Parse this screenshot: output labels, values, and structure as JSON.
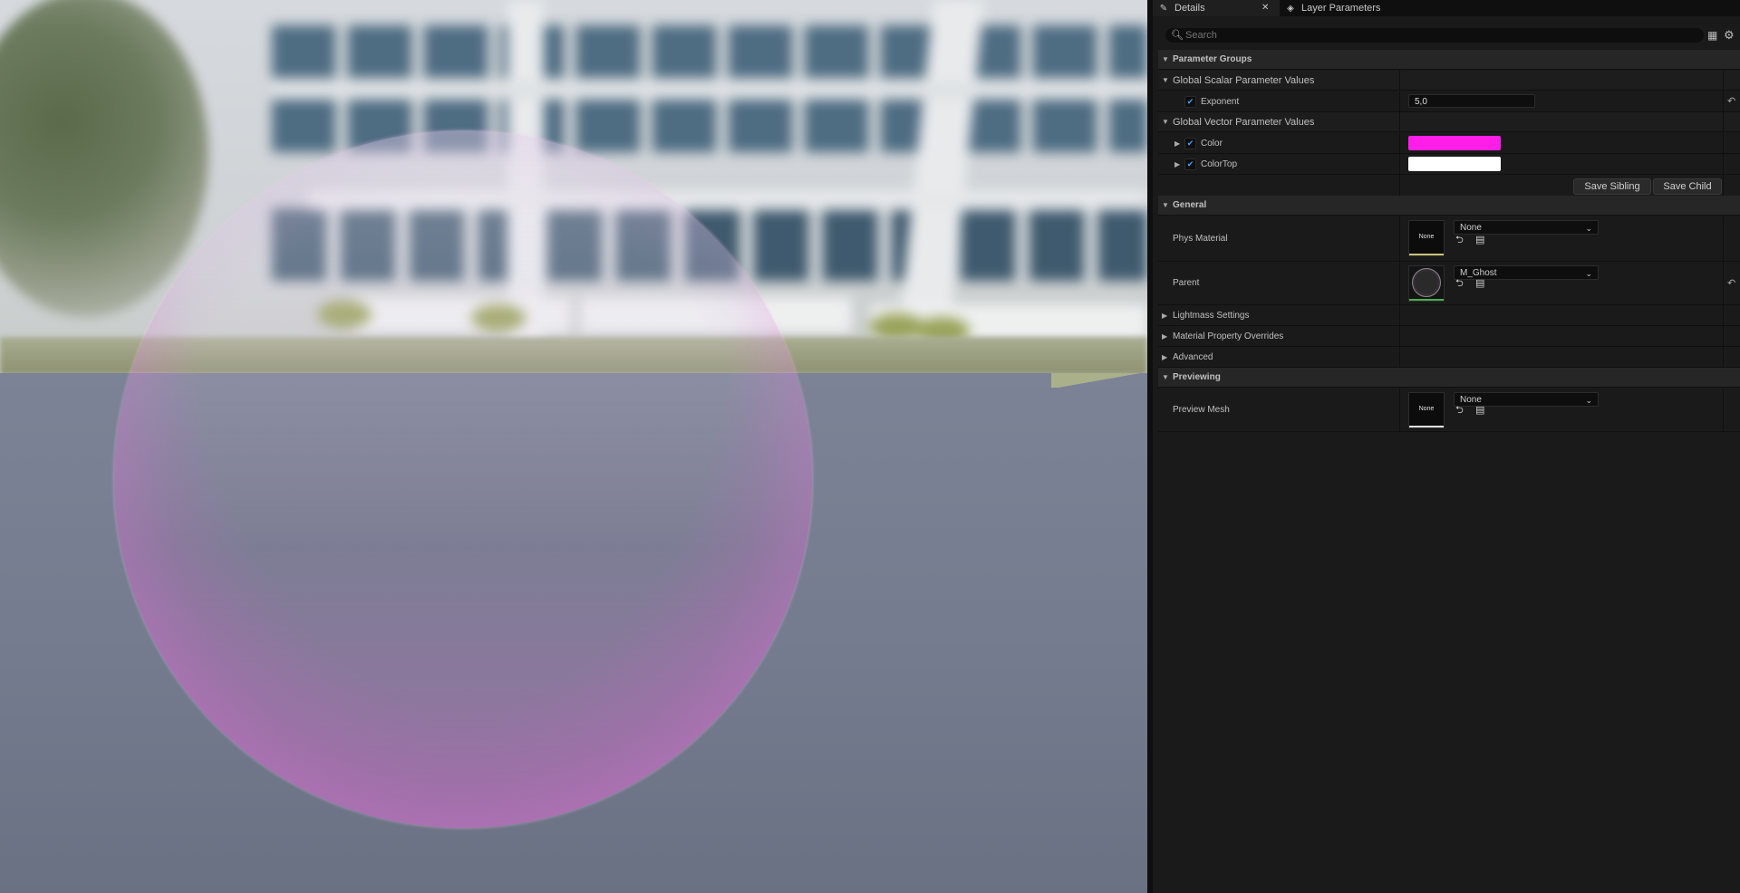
{
  "tabs": {
    "details": "Details",
    "layer": "Layer Parameters"
  },
  "search": {
    "placeholder": "Search"
  },
  "sections": {
    "parameter_groups": "Parameter Groups",
    "global_scalar": "Global Scalar Parameter Values",
    "global_vector": "Global Vector Parameter Values",
    "general": "General",
    "lightmass": "Lightmass Settings",
    "material_overrides": "Material Property Overrides",
    "advanced": "Advanced",
    "previewing": "Previewing"
  },
  "params": {
    "exponent_label": "Exponent",
    "exponent_value": "5,0",
    "color_label": "Color",
    "color_value": "#ff1ee8",
    "colortop_label": "ColorTop",
    "colortop_value": "#ffffff"
  },
  "buttons": {
    "save_sibling": "Save Sibling",
    "save_child": "Save Child"
  },
  "general": {
    "phys_material_label": "Phys Material",
    "phys_material_thumb": "None",
    "phys_material_value": "None",
    "parent_label": "Parent",
    "parent_value": "M_Ghost"
  },
  "previewing": {
    "preview_mesh_label": "Preview Mesh",
    "preview_mesh_thumb": "None",
    "preview_mesh_value": "None"
  }
}
